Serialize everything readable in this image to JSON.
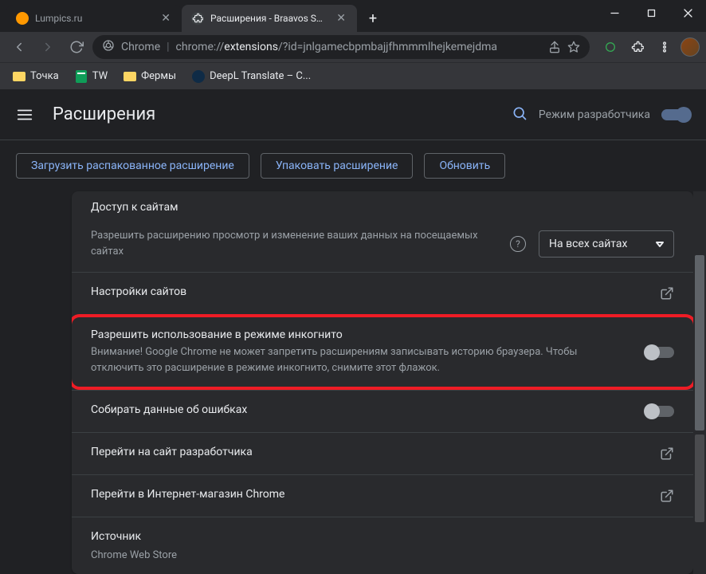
{
  "tabs": [
    {
      "title": "Lumpics.ru"
    },
    {
      "title": "Расширения - Braavos Smart Wa"
    }
  ],
  "url": {
    "prefix": "Chrome",
    "path_pre": "chrome://",
    "path_highlight": "extensions",
    "path_post": "/?id=jnlgamecbpmbajjfhmmmlhejkemejdma"
  },
  "bookmarks": [
    {
      "label": "Точка"
    },
    {
      "label": "TW"
    },
    {
      "label": "Фермы"
    },
    {
      "label": "DeepL Translate – C..."
    }
  ],
  "header": {
    "title": "Расширения",
    "dev_mode": "Режим разработчика"
  },
  "actions": {
    "load_unpacked": "Загрузить распакованное расширение",
    "pack": "Упаковать расширение",
    "update": "Обновить"
  },
  "sections": {
    "site_access_group": "Доступ к сайтам",
    "site_access_desc": "Разрешить расширению просмотр и изменение ваших данных на посещаемых сайтах",
    "site_access_dropdown": "На всех сайтах",
    "site_settings": "Настройки сайтов",
    "incognito_title": "Разрешить использование в режиме инкогнито",
    "incognito_desc": "Внимание! Google Chrome не может запретить расширениям записывать историю браузера. Чтобы отключить это расширение в режиме инкогнито, снимите этот флажок.",
    "collect_errors": "Собирать данные об ошибках",
    "developer_site": "Перейти на сайт разработчика",
    "web_store": "Перейти в Интернет-магазин Chrome",
    "source_label": "Источник",
    "source_value": "Chrome Web Store"
  }
}
